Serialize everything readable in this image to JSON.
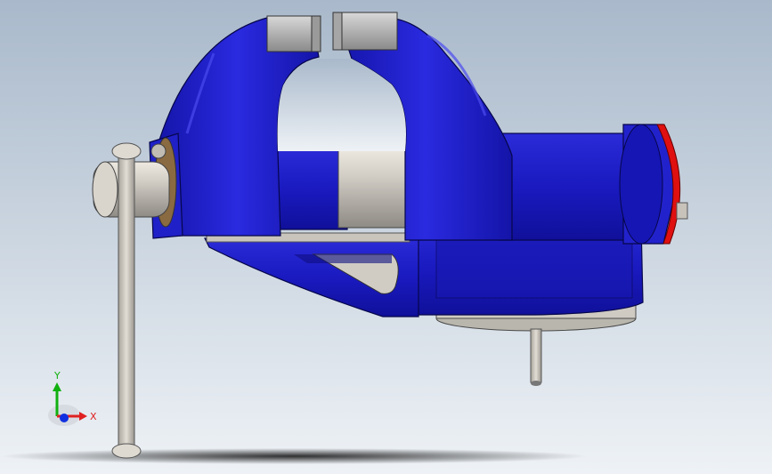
{
  "viewport": {
    "model_name": "bench-vise",
    "colors": {
      "background_top": "#a9b9cb",
      "background_bottom": "#ecf1f6",
      "body_blue": "#1e1ec8",
      "body_blue_dark": "#0c0c86",
      "body_blue_light": "#3a3aee",
      "steel": "#c9c6bf",
      "steel_dark": "#8f8c86",
      "red_ring": "#e01010"
    }
  },
  "triad": {
    "x_label": "X",
    "y_label": "Y",
    "x_color": "#e02020",
    "y_color": "#10b010",
    "z_color": "#1030e0"
  }
}
